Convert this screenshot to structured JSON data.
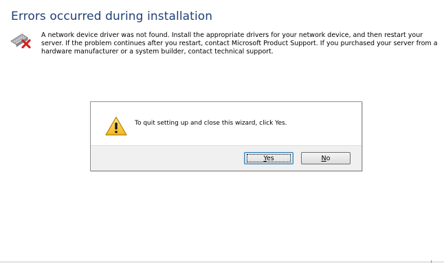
{
  "installer": {
    "title": "Errors occurred during installation",
    "error_icon": "network-adapter-error-icon",
    "message": "A network device driver was not found. Install the appropriate drivers for your network device, and then restart your server. If the problem continues after you restart, contact Microsoft Product Support. If you purchased your server from a hardware manufacturer or a system builder, contact technical support."
  },
  "dialog": {
    "icon": "warning-icon",
    "message": "To quit setting up and close this wizard, click Yes.",
    "buttons": {
      "yes": {
        "label": "Yes",
        "mnemonic": "Y"
      },
      "no": {
        "label": "No",
        "mnemonic": "N"
      }
    }
  },
  "colors": {
    "title": "#1e3f75",
    "dialog_footer": "#f0f0f0",
    "warning_fill": "#f7c52b",
    "error_x": "#d32020"
  }
}
